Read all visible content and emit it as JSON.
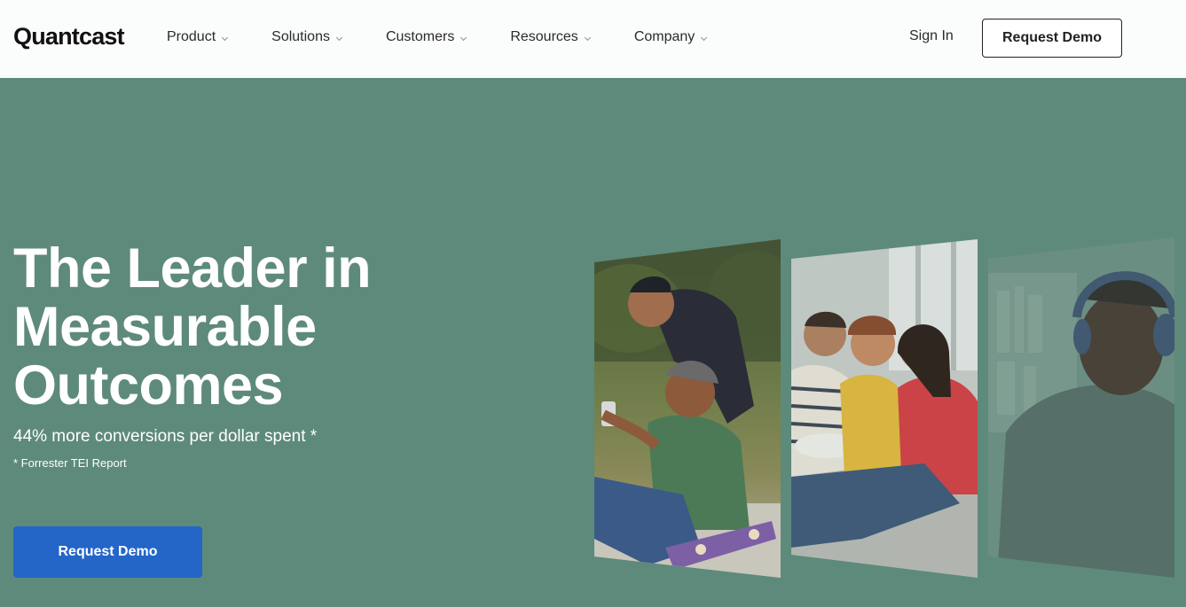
{
  "header": {
    "logo": "Quantcast",
    "nav": [
      {
        "label": "Product"
      },
      {
        "label": "Solutions"
      },
      {
        "label": "Customers"
      },
      {
        "label": "Resources"
      },
      {
        "label": "Company"
      }
    ],
    "sign_in": "Sign In",
    "request_demo": "Request Demo"
  },
  "hero": {
    "title_line1": "The Leader in",
    "title_line2": "Measurable",
    "title_line3": "Outcomes",
    "subtitle": "44% more conversions per dollar spent *",
    "footnote": "* Forrester TEI Report",
    "cta": "Request Demo"
  },
  "colors": {
    "hero_bg": "#5e8a7b",
    "header_bg": "#fbfcfc",
    "cta_bg": "#2366c8"
  },
  "icons": {
    "nav_dropdown": "chevron-down-icon"
  }
}
